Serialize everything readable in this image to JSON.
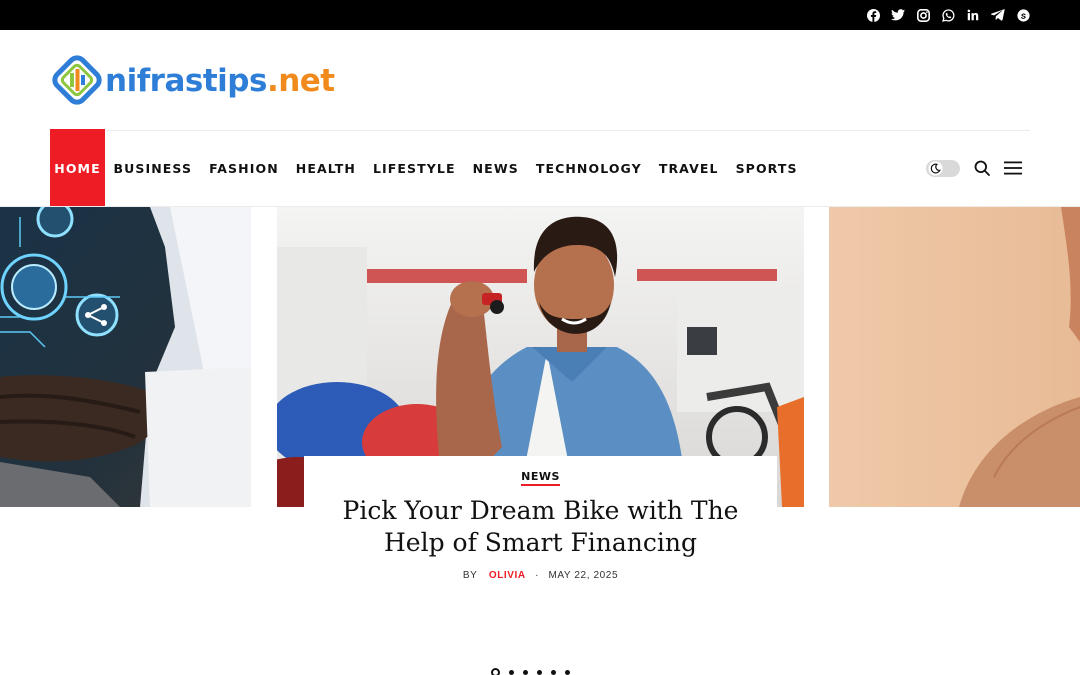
{
  "logo": {
    "part1": "nifrastips",
    "part2": ".net"
  },
  "social": [
    "facebook-icon",
    "twitter-icon",
    "instagram-icon",
    "whatsapp-icon",
    "linkedin-icon",
    "telegram-icon",
    "skype-icon"
  ],
  "nav": {
    "items": [
      {
        "label": "HOME",
        "active": true
      },
      {
        "label": "BUSINESS"
      },
      {
        "label": "FASHION"
      },
      {
        "label": "HEALTH"
      },
      {
        "label": "LIFESTYLE"
      },
      {
        "label": "NEWS"
      },
      {
        "label": "TECHNOLOGY"
      },
      {
        "label": "TRAVEL"
      },
      {
        "label": "SPORTS"
      }
    ]
  },
  "tools": {
    "dark_mode": "moon-icon",
    "search": "search-icon",
    "menu": "hamburger-menu-icon"
  },
  "featured": {
    "category": "NEWS",
    "title": "Pick Your Dream Bike with The Help of Smart Financing",
    "by": "BY",
    "author": "OLIVIA",
    "separator": "·",
    "date": "MAY 22, 2025"
  },
  "slider": {
    "count": 6,
    "active_index": 0
  },
  "colors": {
    "accent": "#ee1c25",
    "logo_blue": "#2e7ed8",
    "logo_orange": "#f08a1c",
    "topbar": "#000000"
  }
}
